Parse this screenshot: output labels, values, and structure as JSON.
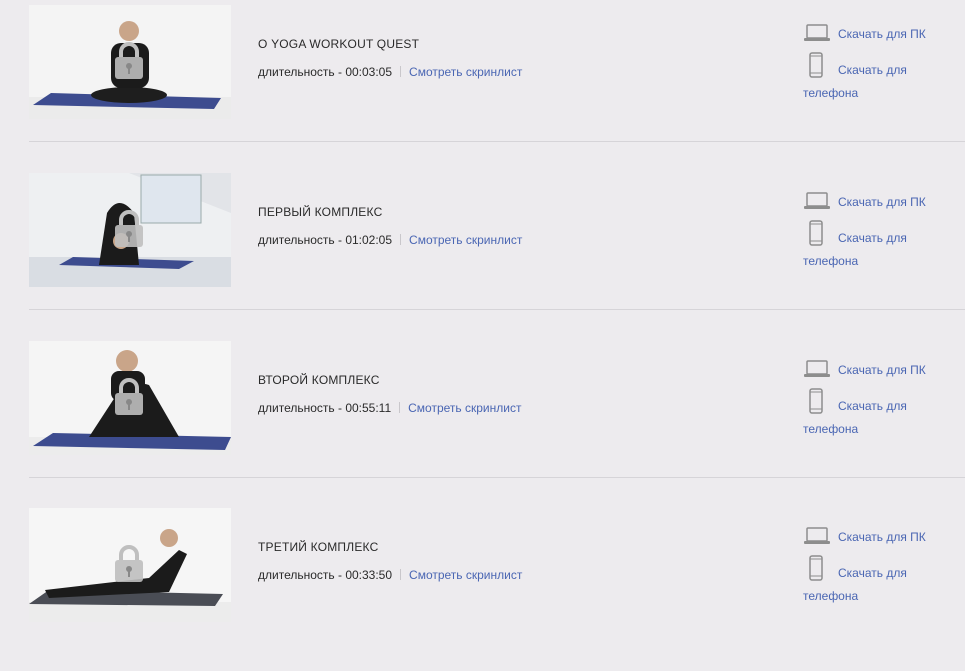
{
  "labels": {
    "duration_prefix": "длительность - ",
    "screenlist_link": "Смотреть скринлист",
    "download_pc": "Скачать для ПК",
    "download_phone_line1": "Скачать для",
    "download_phone_line2": "телефона"
  },
  "videos": [
    {
      "title": "О YOGA WORKOUT QUEST",
      "duration": "00:03:05"
    },
    {
      "title": "ПЕРВЫЙ КОМПЛЕКС",
      "duration": "01:02:05"
    },
    {
      "title": "ВТОРОЙ КОМПЛЕКС",
      "duration": "00:55:11"
    },
    {
      "title": "ТРЕТИЙ КОМПЛЕКС",
      "duration": "00:33:50"
    }
  ],
  "icons": {
    "lock": "lock-icon",
    "laptop": "laptop-icon",
    "phone": "phone-icon"
  },
  "colors": {
    "background": "#edebee",
    "link": "#4a66b3",
    "text": "#2a2a2a",
    "mat": "#3d4c8f"
  }
}
